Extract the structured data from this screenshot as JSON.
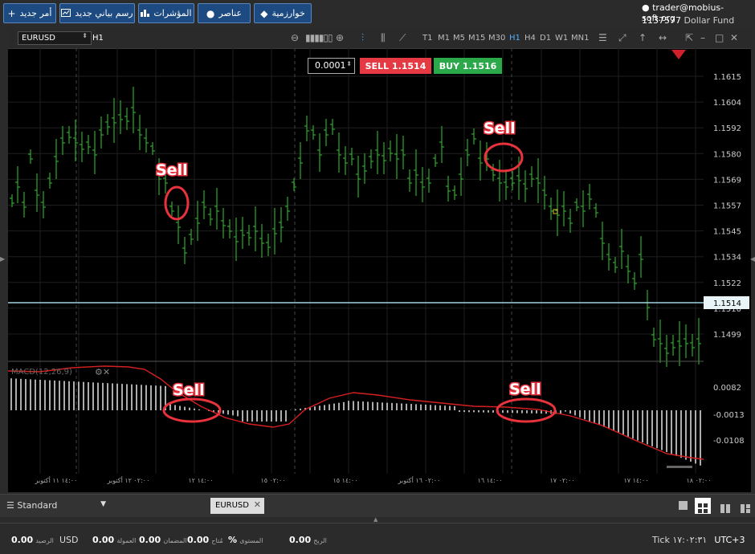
{
  "toolbar": {
    "buttons": [
      {
        "label": "أمر جديد",
        "icon": "plus-icon"
      },
      {
        "label": "رسم بياني جديد",
        "icon": "chart-icon"
      },
      {
        "label": "المؤشرات",
        "icon": "bars-icon"
      },
      {
        "label": "عناصر",
        "icon": "shapes-icon"
      },
      {
        "label": "خوارزمية",
        "icon": "diamond-icon"
      }
    ]
  },
  "account": {
    "email": "trader@mobius-soft.org",
    "id": "1137577",
    "fund": "Dollar Fund"
  },
  "chart_toolbar": {
    "symbol": "EURUSD",
    "timeframe_current": "H1",
    "timeframes": [
      "T1",
      "M1",
      "M5",
      "M15",
      "M30",
      "H1",
      "H4",
      "D1",
      "W1",
      "MN1"
    ],
    "active_timeframe": "H1"
  },
  "trade": {
    "qty": "0.0001",
    "sell_label": "SELL 1.1514",
    "buy_label": "BUY 1.1516"
  },
  "chart_data": {
    "type": "ohlc",
    "symbol": "EURUSD",
    "timeframe": "H1",
    "price_axis": [
      "1.1615",
      "1.1604",
      "1.1592",
      "1.1580",
      "1.1569",
      "1.1557",
      "1.1545",
      "1.1534",
      "1.1522",
      "1.1510",
      "1.1499"
    ],
    "current_price": "1.1514",
    "macd_label": "MACD(12,26,9)",
    "macd_axis": [
      "0.0082",
      "-0.0013",
      "-0.0108"
    ],
    "time_axis": [
      "١٤:٠٠ ١١ أكتوبر",
      "٠٢:٠٠ ١٢ أكتوبر",
      "١٤:٠٠ ١٢",
      "٠٢:٠٠ ١٥",
      "١٤:٠٠ ١٥",
      "٠٢:٠٠ ١٦ أكتوبر",
      "١٤:٠٠ ١٦",
      "٠٢:٠٠ ١٧",
      "١٤:٠٠ ١٧",
      "٠٢:٠٠ ١٨"
    ],
    "annotations": [
      "Sell",
      "Sell",
      "Sell",
      "Sell"
    ]
  },
  "bottom": {
    "template": "Standard",
    "tab": "EURUSD",
    "balance_label": "الرصيد",
    "balance": "0.00",
    "currency": "USD",
    "fees_label": "العمولة",
    "fees": "0.00",
    "equity_label": "المضمان",
    "equity": "0.00",
    "margin_label": "مُتاح",
    "margin": "0.00",
    "level_label": "المستوى",
    "level": "%",
    "profit_label": "الربح",
    "profit": "0.00",
    "clock": "Tick ١٧:٠٢:٣١",
    "tz": "UTC+3"
  },
  "colors": {
    "bull": "#2eaa2e",
    "bear": "#2eaa2e",
    "annotation": "#e8323c",
    "signal": "#d52020",
    "accent": "#4db0ff"
  }
}
